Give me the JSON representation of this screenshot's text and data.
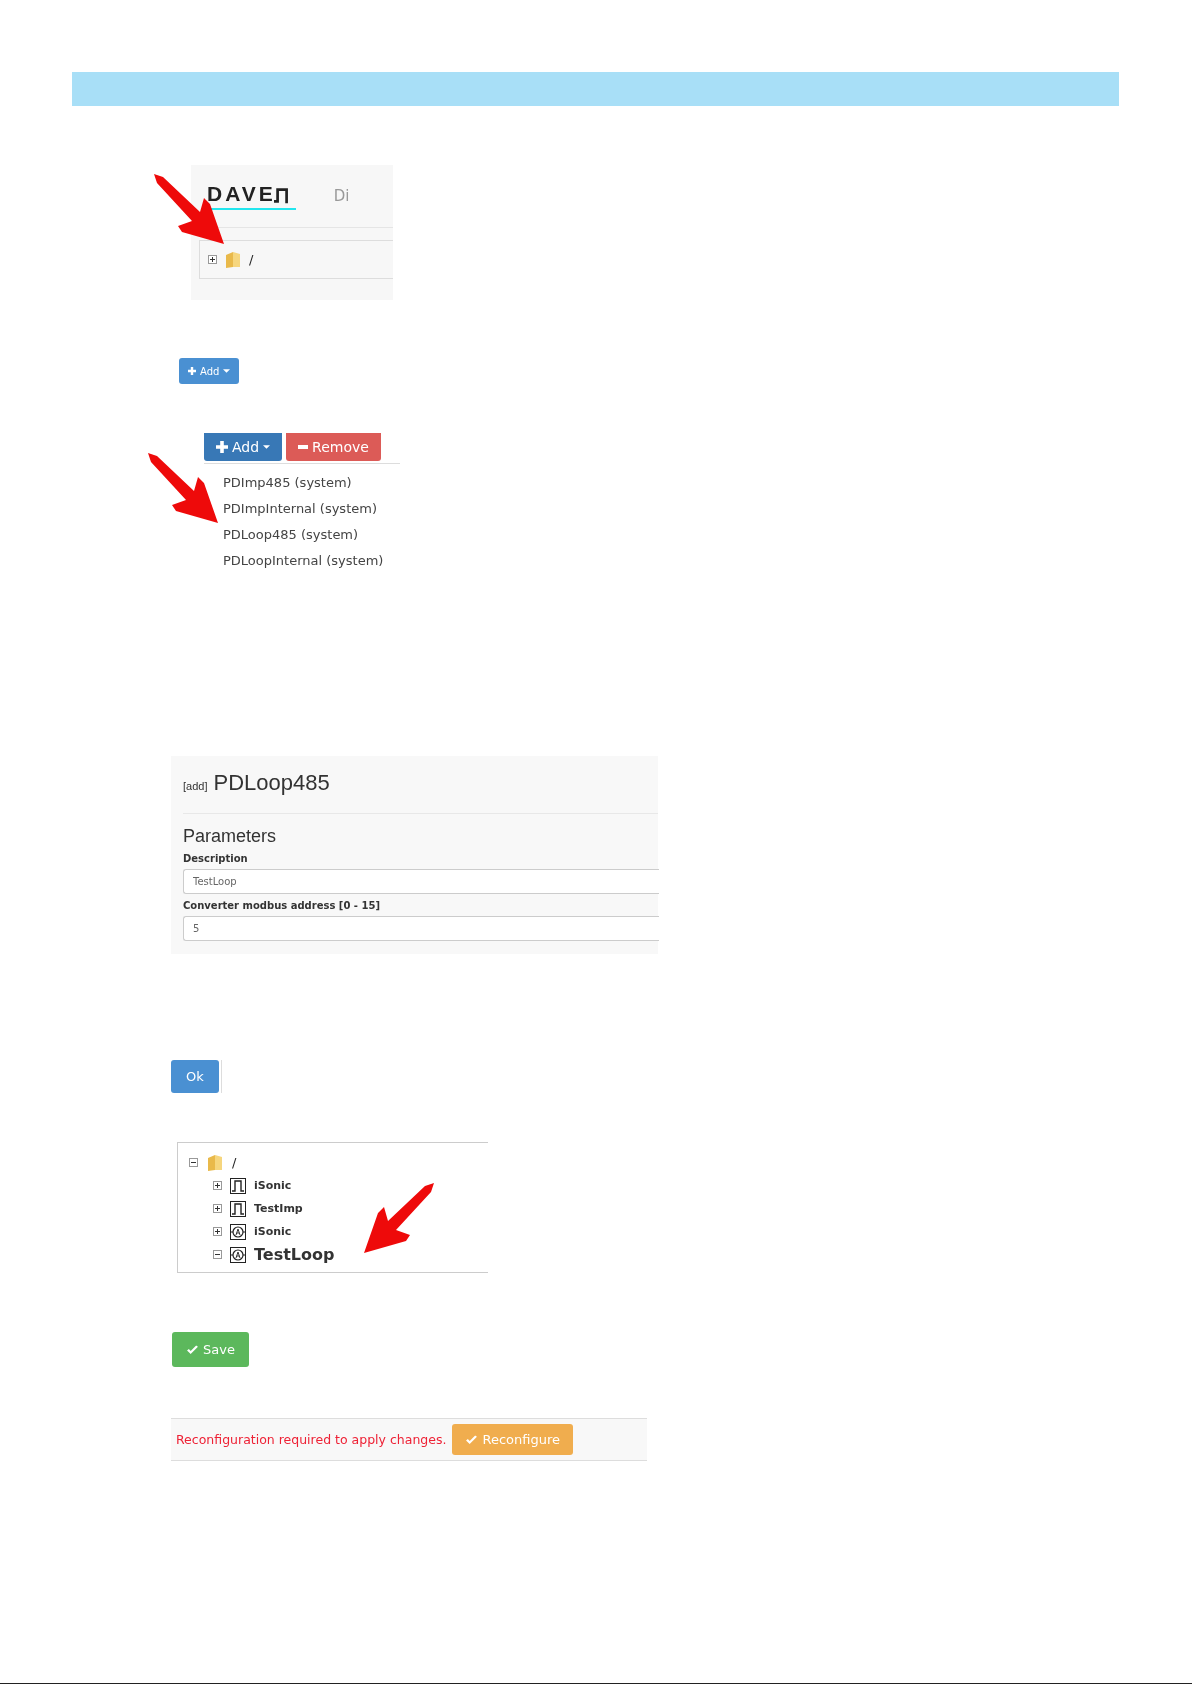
{
  "shot_start": {
    "logo": "DAVE",
    "nav_text": "Di",
    "tree_root": {
      "label": "/",
      "expanded": false
    }
  },
  "add_button": {
    "label": "Add"
  },
  "shot_menu": {
    "buttons": [
      {
        "label": "Add",
        "kind": "add"
      },
      {
        "label": "Remove",
        "kind": "remove"
      }
    ],
    "items": [
      "PDImp485 (system)",
      "PDImpInternal (system)",
      "PDLoop485 (system)",
      "PDLoopInternal (system)"
    ]
  },
  "shot_form": {
    "tag": "[add]",
    "title": "PDLoop485",
    "section": "Parameters",
    "fields": [
      {
        "label": "Description",
        "value": "TestLoop"
      },
      {
        "label": "Converter modbus address [0 - 15]",
        "value": "5"
      }
    ]
  },
  "ok_button": {
    "label": "Ok"
  },
  "shot_tree": {
    "root": {
      "label": "/",
      "expanded": true,
      "children": [
        {
          "label": "iSonic",
          "kind": "pulse",
          "expanded": false,
          "selected": false
        },
        {
          "label": "TestImp",
          "kind": "pulse",
          "expanded": false,
          "selected": false
        },
        {
          "label": "iSonic",
          "kind": "loop",
          "expanded": false,
          "selected": false
        },
        {
          "label": "TestLoop",
          "kind": "loop",
          "expanded": true,
          "selected": true
        }
      ]
    }
  },
  "save_button": {
    "label": "Save"
  },
  "shot_notice": {
    "message": "Reconfiguration required to apply changes.",
    "button": "Reconfigure"
  }
}
